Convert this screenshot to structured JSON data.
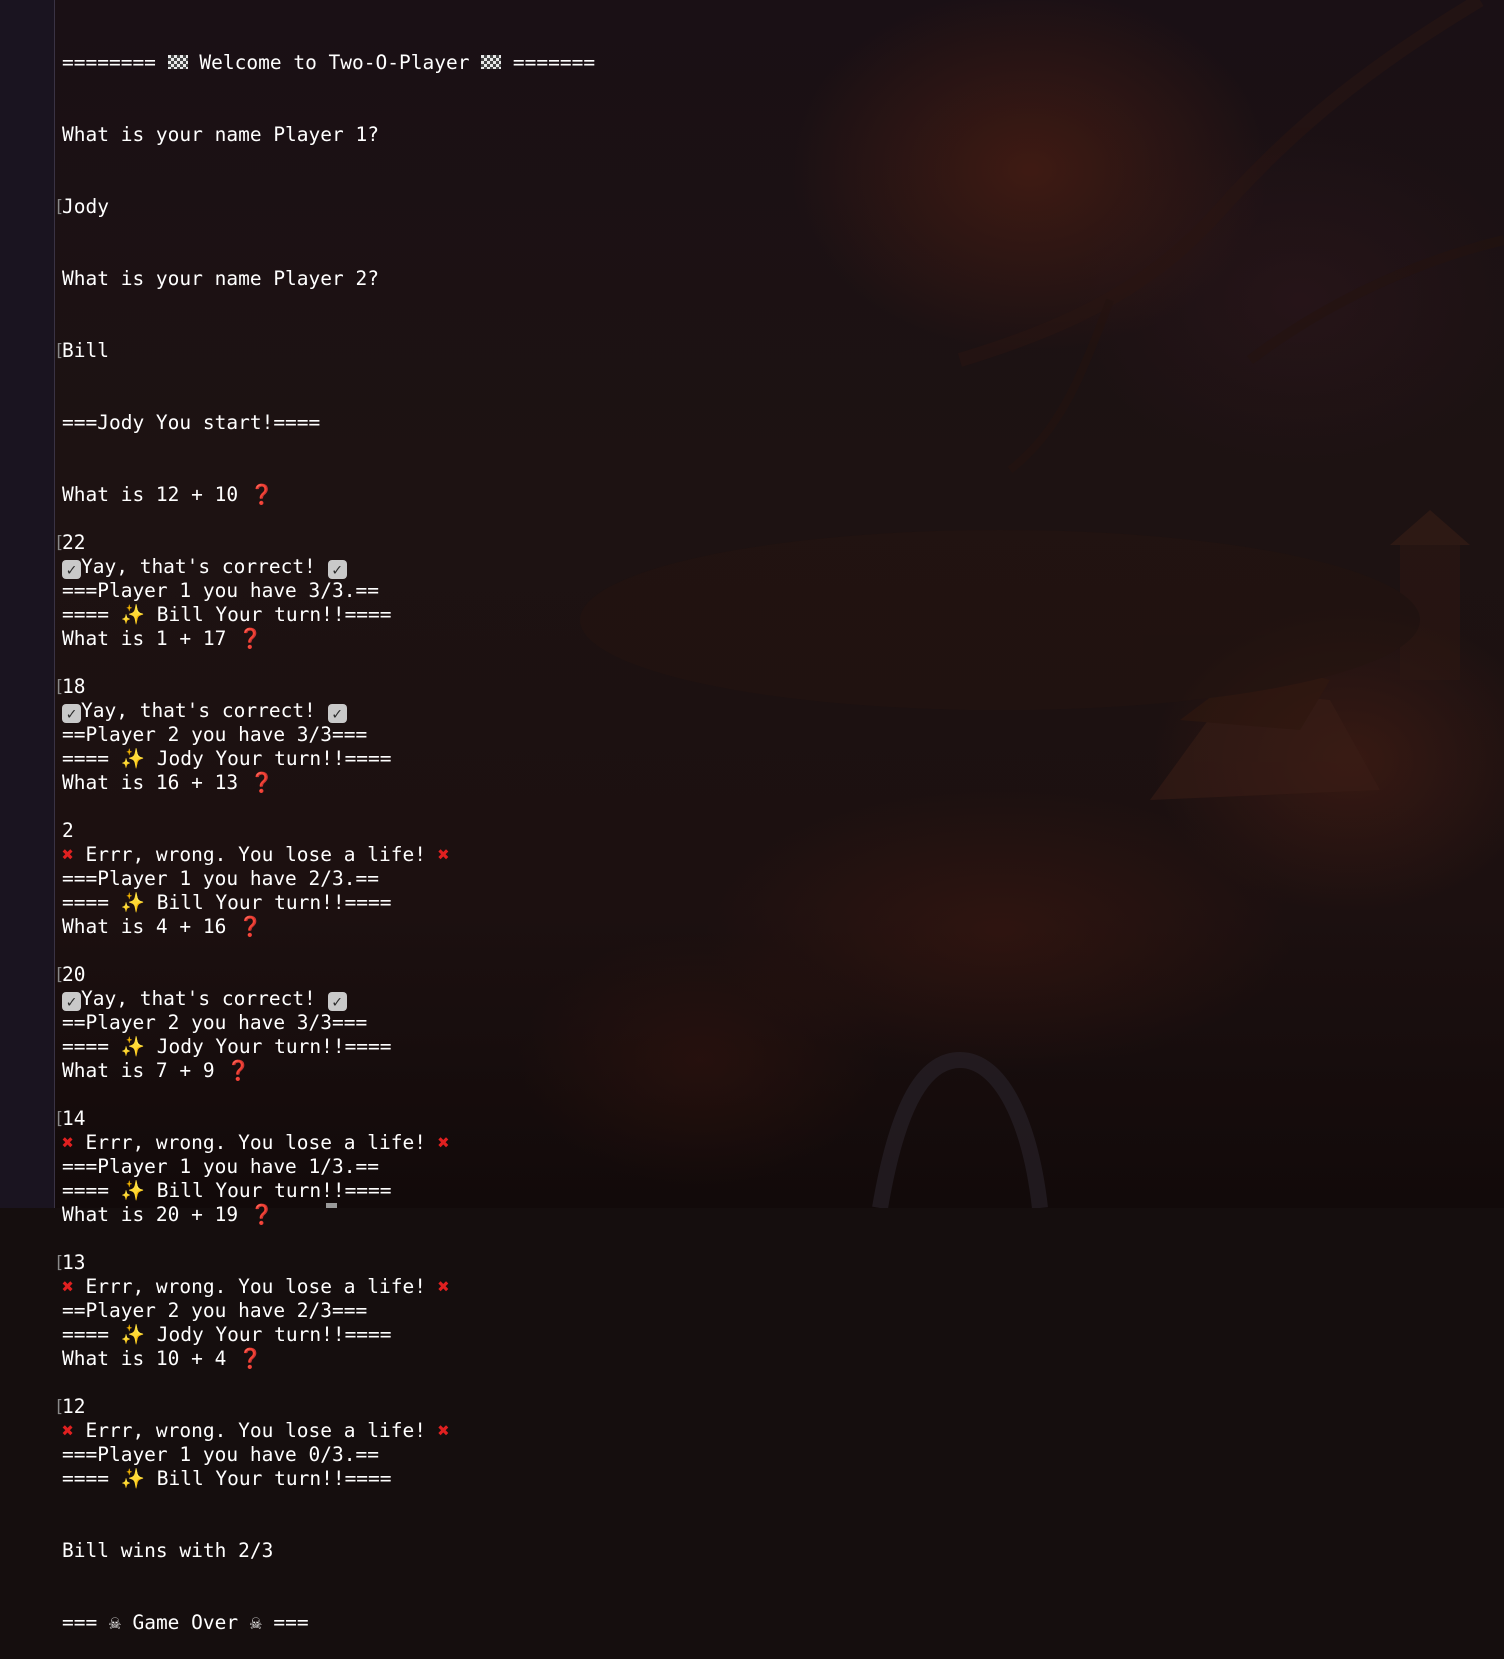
{
  "terminal": {
    "welcome": {
      "left": "======== ",
      "title": " Welcome to Two-O-Player ",
      "right": " =======",
      "flag": "checkered-flag-icon"
    },
    "prompt_p1": "What is your name Player 1?",
    "input_p1": "Jody",
    "prompt_p2": "What is your name Player 2?",
    "input_p2": "Bill",
    "start": "===Jody You start!====",
    "rounds": [
      {
        "question": "What is 12 + 10 ",
        "answer": "22",
        "result": "Yay, that's correct! ",
        "correct": true,
        "score": "===Player 1 you have 3/3.==",
        "turn_left": "==== ",
        "turn_right": " Bill Your turn!!===="
      },
      {
        "question": "What is 1 + 17 ",
        "answer": "18",
        "result": "Yay, that's correct! ",
        "correct": true,
        "score": "==Player 2 you have 3/3===",
        "turn_left": "==== ",
        "turn_right": " Jody Your turn!!===="
      },
      {
        "question": "What is 16 + 13 ",
        "answer": "2",
        "result": " Errr, wrong. You lose a life! ",
        "correct": false,
        "score": "===Player 1 you have 2/3.==",
        "turn_left": "==== ",
        "turn_right": " Bill Your turn!!===="
      },
      {
        "question": "What is 4 + 16 ",
        "answer": "20",
        "result": "Yay, that's correct! ",
        "correct": true,
        "score": "==Player 2 you have 3/3===",
        "turn_left": "==== ",
        "turn_right": " Jody Your turn!!===="
      },
      {
        "question": "What is 7 + 9 ",
        "answer": "14",
        "result": " Errr, wrong. You lose a life! ",
        "correct": false,
        "score": "===Player 1 you have 1/3.==",
        "turn_left": "==== ",
        "turn_right": " Bill Your turn!!===="
      },
      {
        "question": "What is 20 + 19 ",
        "answer": "13",
        "result": " Errr, wrong. You lose a life! ",
        "correct": false,
        "score": "==Player 2 you have 2/3===",
        "turn_left": "==== ",
        "turn_right": " Jody Your turn!!===="
      },
      {
        "question": "What is 10 + 4 ",
        "answer": "12",
        "result": " Errr, wrong. You lose a life! ",
        "correct": false,
        "score": "===Player 1 you have 0/3.==",
        "turn_left": "==== ",
        "turn_right": " Bill Your turn!!===="
      }
    ],
    "winner": "Bill wins with 2/3",
    "game_over": {
      "left": "=== ",
      "text": " Game Over ",
      "right": " ==="
    },
    "icons": {
      "question": "❓",
      "check": "✓",
      "cross": "✖",
      "sparkle": "✨",
      "skull": "☠"
    },
    "colors": {
      "text": "#ffffff",
      "question_mark": "#d62a2a",
      "cross": "#e02020",
      "sparkle": "#f2cf4a"
    }
  }
}
